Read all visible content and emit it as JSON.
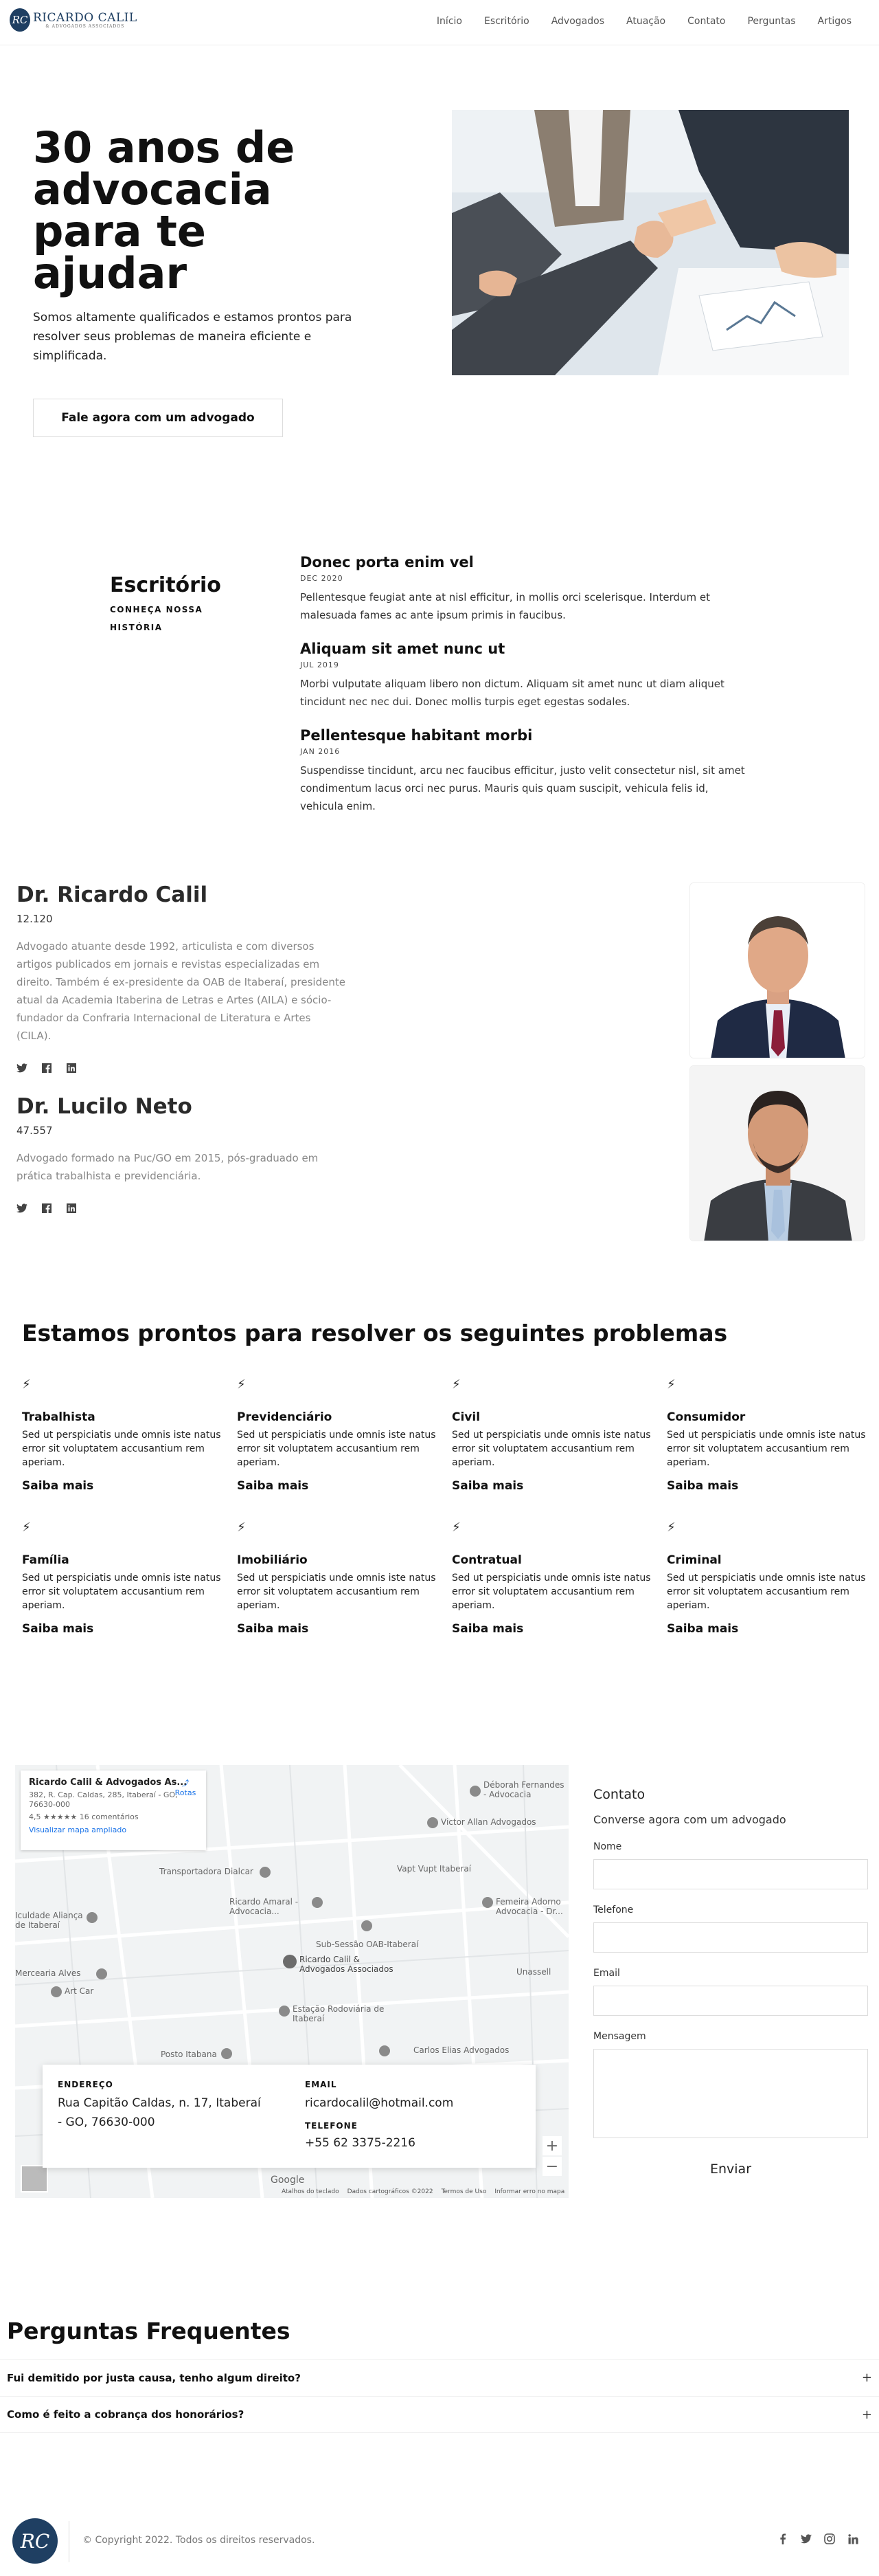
{
  "header": {
    "logo_name": "RICARDO CALIL",
    "logo_sub": "& ADVOGADOS ASSOCIADOS",
    "logo_monogram": "RC",
    "nav": [
      "Início",
      "Escritório",
      "Advogados",
      "Atuação",
      "Contato",
      "Perguntas",
      "Artigos"
    ]
  },
  "hero": {
    "title": "30 anos de advocacia para te ajudar",
    "text": "Somos altamente qualificados e estamos prontos para resolver seus problemas de maneira eficiente e simplificada.",
    "button": "Fale agora com um advogado"
  },
  "office": {
    "title": "Escritório",
    "subtitle": "CONHEÇA NOSSA HISTÓRIA",
    "timeline": [
      {
        "title": "Donec porta enim vel",
        "date": "DEC 2020",
        "text": "Pellentesque feugiat ante at nisl efficitur, in mollis orci scelerisque. Interdum et malesuada fames ac ante ipsum primis in faucibus."
      },
      {
        "title": "Aliquam sit amet nunc ut",
        "date": "JUL 2019",
        "text": "Morbi vulputate aliquam libero non dictum. Aliquam sit amet nunc ut diam aliquet tincidunt nec nec dui. Donec mollis turpis eget egestas sodales."
      },
      {
        "title": "Pellentesque habitant morbi",
        "date": "JAN 2016",
        "text": "Suspendisse tincidunt, arcu nec faucibus efficitur, justo velit consectetur nisl, sit amet condimentum lacus orci nec purus. Mauris quis quam suscipit, vehicula felis id, vehicula enim."
      }
    ]
  },
  "lawyers": [
    {
      "name": "Dr. Ricardo Calil",
      "oab": "12.120",
      "bio": "Advogado atuante desde 1992, articulista e com diversos artigos publicados em jornais e revistas especializadas em direito. Também é ex-presidente da OAB de Itaberaí, presidente atual da Academia Itaberina de Letras e Artes (AILA) e sócio-fundador da Confraria Internacional de Literatura e Artes (CILA)."
    },
    {
      "name": "Dr. Lucilo Neto",
      "oab": "47.557",
      "bio": "Advogado formado na Puc/GO em 2015, pós-graduado em prática trabalhista e previdenciária."
    }
  ],
  "problems": {
    "title": "Estamos prontos para resolver os seguintes problemas",
    "link_label": "Saiba mais",
    "items": [
      {
        "name": "Trabalhista",
        "text": "Sed ut perspiciatis unde omnis iste natus error sit voluptatem accusantium rem aperiam."
      },
      {
        "name": "Previdenciário",
        "text": "Sed ut perspiciatis unde omnis iste natus error sit voluptatem accusantium rem aperiam."
      },
      {
        "name": "Civil",
        "text": "Sed ut perspiciatis unde omnis iste natus error sit voluptatem accusantium rem aperiam."
      },
      {
        "name": "Consumidor",
        "text": "Sed ut perspiciatis unde omnis iste natus error sit voluptatem accusantium rem aperiam."
      },
      {
        "name": "Família",
        "text": "Sed ut perspiciatis unde omnis iste natus error sit voluptatem accusantium rem aperiam."
      },
      {
        "name": "Imobiliário",
        "text": "Sed ut perspiciatis unde omnis iste natus error sit voluptatem accusantium rem aperiam."
      },
      {
        "name": "Contratual",
        "text": "Sed ut perspiciatis unde omnis iste natus error sit voluptatem accusantium rem aperiam."
      },
      {
        "name": "Criminal",
        "text": "Sed ut perspiciatis unde omnis iste natus error sit voluptatem accusantium rem aperiam."
      }
    ]
  },
  "map": {
    "card_name": "Ricardo Calil & Advogados As...",
    "card_address": "382, R. Cap. Caldas, 285, Itaberaí - GO, 76630-000",
    "card_rating": "4,5 ★★★★★   16 comentários",
    "card_link": "Visualizar mapa ampliado",
    "card_directions": "Rotas",
    "labels": [
      "Déborah Fernandes - Advocacia",
      "Victor Allan Advogados",
      "Transportadora Dialcar",
      "Vapt Vupt Itaberaí",
      "Ricardo Amaral - Advocacia...",
      "Femeira Adorno Advocacia - Dr...",
      "Sub-Sessão OAB-Itaberaí",
      "Ricardo Calil & Advogados Associados",
      "Unassell",
      "Estação Rodoviária de Itaberaí",
      "Carlos Elias Advogados",
      "Posto Itabana",
      "Iculdade Aliança de Itaberaí",
      "Mercearia Alves",
      "Art Car"
    ],
    "google": "Google",
    "footer": [
      "Atalhos do teclado",
      "Dados cartográficos ©2022",
      "Termos de Uso",
      "Informar erro no mapa"
    ]
  },
  "info": {
    "address_label": "ENDEREÇO",
    "address": "Rua Capitão Caldas, n. 17, Itaberaí - GO, 76630-000",
    "email_label": "EMAIL",
    "email": "ricardocalil@hotmail.com",
    "phone_label": "TELEFONE",
    "phone": "+55 62 3375-2216"
  },
  "contact": {
    "title": "Contato",
    "subtitle": "Converse agora com um advogado",
    "name_label": "Nome",
    "phone_label": "Telefone",
    "email_label": "Email",
    "message_label": "Mensagem",
    "send": "Enviar"
  },
  "faq": {
    "title": "Perguntas Frequentes",
    "items": [
      "Fui demitido por justa causa, tenho algum direito?",
      "Como é feito a cobrança dos honorários?"
    ]
  },
  "footer": {
    "copyright": "© Copyright 2022. Todos os direitos reservados."
  },
  "colors": {
    "brand": "#1f3f62",
    "text": "#111111",
    "muted": "#888888"
  }
}
